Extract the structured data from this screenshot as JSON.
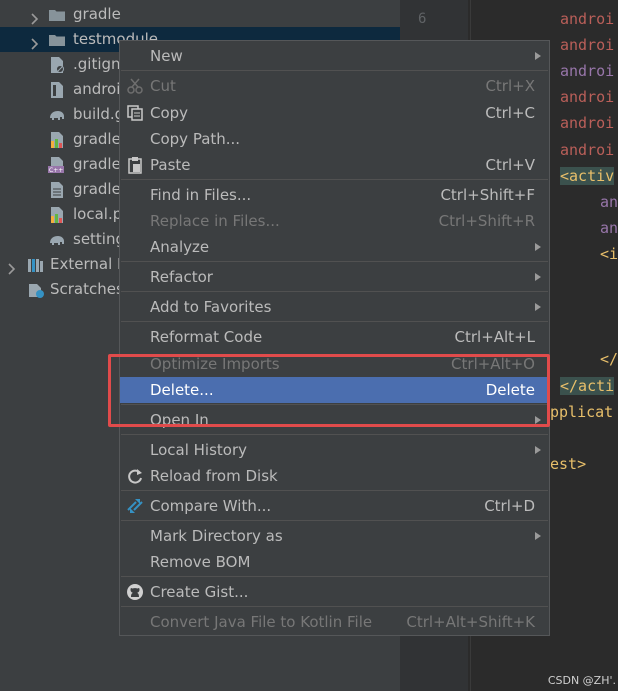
{
  "tree": {
    "rows": [
      {
        "label": "gradle",
        "kind": "folder",
        "chevron": true
      },
      {
        "label": "testmodule",
        "kind": "folder",
        "chevron": true
      },
      {
        "label": ".gitign",
        "kind": "git-file"
      },
      {
        "label": "androi",
        "kind": "gradle-file"
      },
      {
        "label": "build.g",
        "kind": "gradle-elephant"
      },
      {
        "label": "gradle",
        "kind": "gradle-file-bar"
      },
      {
        "label": "gradle",
        "kind": "gradle-cpp"
      },
      {
        "label": "gradle",
        "kind": "text-file"
      },
      {
        "label": "local.p",
        "kind": "properties-bar"
      },
      {
        "label": "setting",
        "kind": "gradle-elephant"
      },
      {
        "label": "External L",
        "kind": "libraries",
        "chevron": true
      },
      {
        "label": "Scratches",
        "kind": "scratches"
      }
    ]
  },
  "editor": {
    "line_number": "6",
    "lines": [
      {
        "text": "androi",
        "cls": "attr"
      },
      {
        "text": "androi",
        "cls": "attr"
      },
      {
        "text": "androi",
        "cls": "attr2"
      },
      {
        "text": "androi",
        "cls": "attr"
      },
      {
        "text": "androi",
        "cls": "attr"
      },
      {
        "text": "androi",
        "cls": "attr"
      },
      {
        "text": "<activ",
        "cls": "tag"
      },
      {
        "text": "an",
        "cls": "attr2"
      },
      {
        "text": "an",
        "cls": "attr2"
      },
      {
        "text": "<i",
        "cls": "tag"
      },
      {
        "text": "</",
        "cls": "tag"
      },
      {
        "text": "</acti",
        "cls": "tag"
      },
      {
        "text": "pplicat",
        "cls": "tag"
      },
      {
        "text": "est>",
        "cls": "tag"
      }
    ]
  },
  "menu": {
    "new": "New",
    "cut": "Cut",
    "cut_sc": "Ctrl+X",
    "copy": "Copy",
    "copy_sc": "Ctrl+C",
    "copy_path": "Copy Path...",
    "paste": "Paste",
    "paste_sc": "Ctrl+V",
    "find_in_files": "Find in Files...",
    "find_sc": "Ctrl+Shift+F",
    "replace_in_files": "Replace in Files...",
    "replace_sc": "Ctrl+Shift+R",
    "analyze": "Analyze",
    "refactor": "Refactor",
    "add_to_favorites": "Add to Favorites",
    "reformat_code": "Reformat Code",
    "reformat_sc": "Ctrl+Alt+L",
    "optimize_imports": "Optimize Imports",
    "optimize_sc": "Ctrl+Alt+O",
    "delete": "Delete...",
    "delete_sc": "Delete",
    "open_in": "Open In",
    "local_history": "Local History",
    "reload_from_disk": "Reload from Disk",
    "compare_with": "Compare With...",
    "compare_sc": "Ctrl+D",
    "mark_directory_as": "Mark Directory as",
    "remove_bom": "Remove BOM",
    "create_gist": "Create Gist...",
    "convert_java": "Convert Java File to Kotlin File",
    "convert_sc": "Ctrl+Alt+Shift+K"
  },
  "watermark": "CSDN @ZH'."
}
